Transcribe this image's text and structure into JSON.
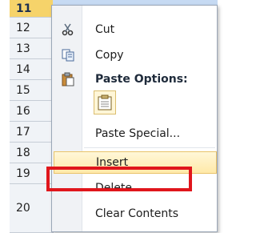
{
  "rows": [
    "11",
    "12",
    "13",
    "14",
    "15",
    "16",
    "17",
    "18",
    "19",
    "20"
  ],
  "menu": {
    "cut": "Cut",
    "copy": "Copy",
    "paste_options": "Paste Options:",
    "paste_special": "Paste Special...",
    "insert": "Insert",
    "delete": "Delete",
    "clear_contents": "Clear Contents"
  },
  "icons": {
    "cut": "scissors-icon",
    "copy": "copy-icon",
    "paste": "clipboard-icon",
    "paste_option": "paste-default-icon"
  },
  "colors": {
    "selected_row": "#f6d36a",
    "highlight": "#e0161c",
    "hover": "#ffe9a8"
  }
}
